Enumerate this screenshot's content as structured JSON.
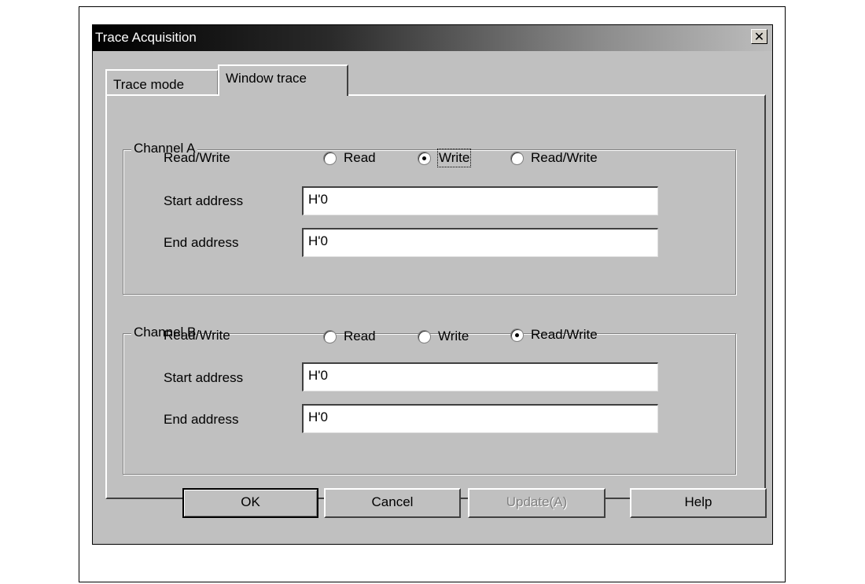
{
  "window": {
    "title": "Trace Acquisition",
    "close_glyph": "✕"
  },
  "tabs": [
    {
      "label": "Trace mode",
      "active": false
    },
    {
      "label": "Window trace",
      "active": true
    }
  ],
  "channel_a": {
    "title": "Channel A",
    "rw_label": "Read/Write",
    "options": [
      "Read",
      "Write",
      "Read/Write"
    ],
    "selected": "Write",
    "start_label": "Start address",
    "start_value": "H'0",
    "end_label": "End address",
    "end_value": "H'0"
  },
  "channel_b": {
    "title": "Channel B",
    "rw_label": "Read/Write",
    "options": [
      "Read",
      "Write",
      "Read/Write"
    ],
    "selected": "Read/Write",
    "start_label": "Start address",
    "start_value": "H'0",
    "end_label": "End address",
    "end_value": "H'0"
  },
  "buttons": {
    "ok": "OK",
    "cancel": "Cancel",
    "update": "Update(A)",
    "help": "Help"
  },
  "colors": {
    "dialog_bg": "#c0c0c0",
    "title_gradient_start": "#000000",
    "title_gradient_end": "#bdbdbd"
  }
}
